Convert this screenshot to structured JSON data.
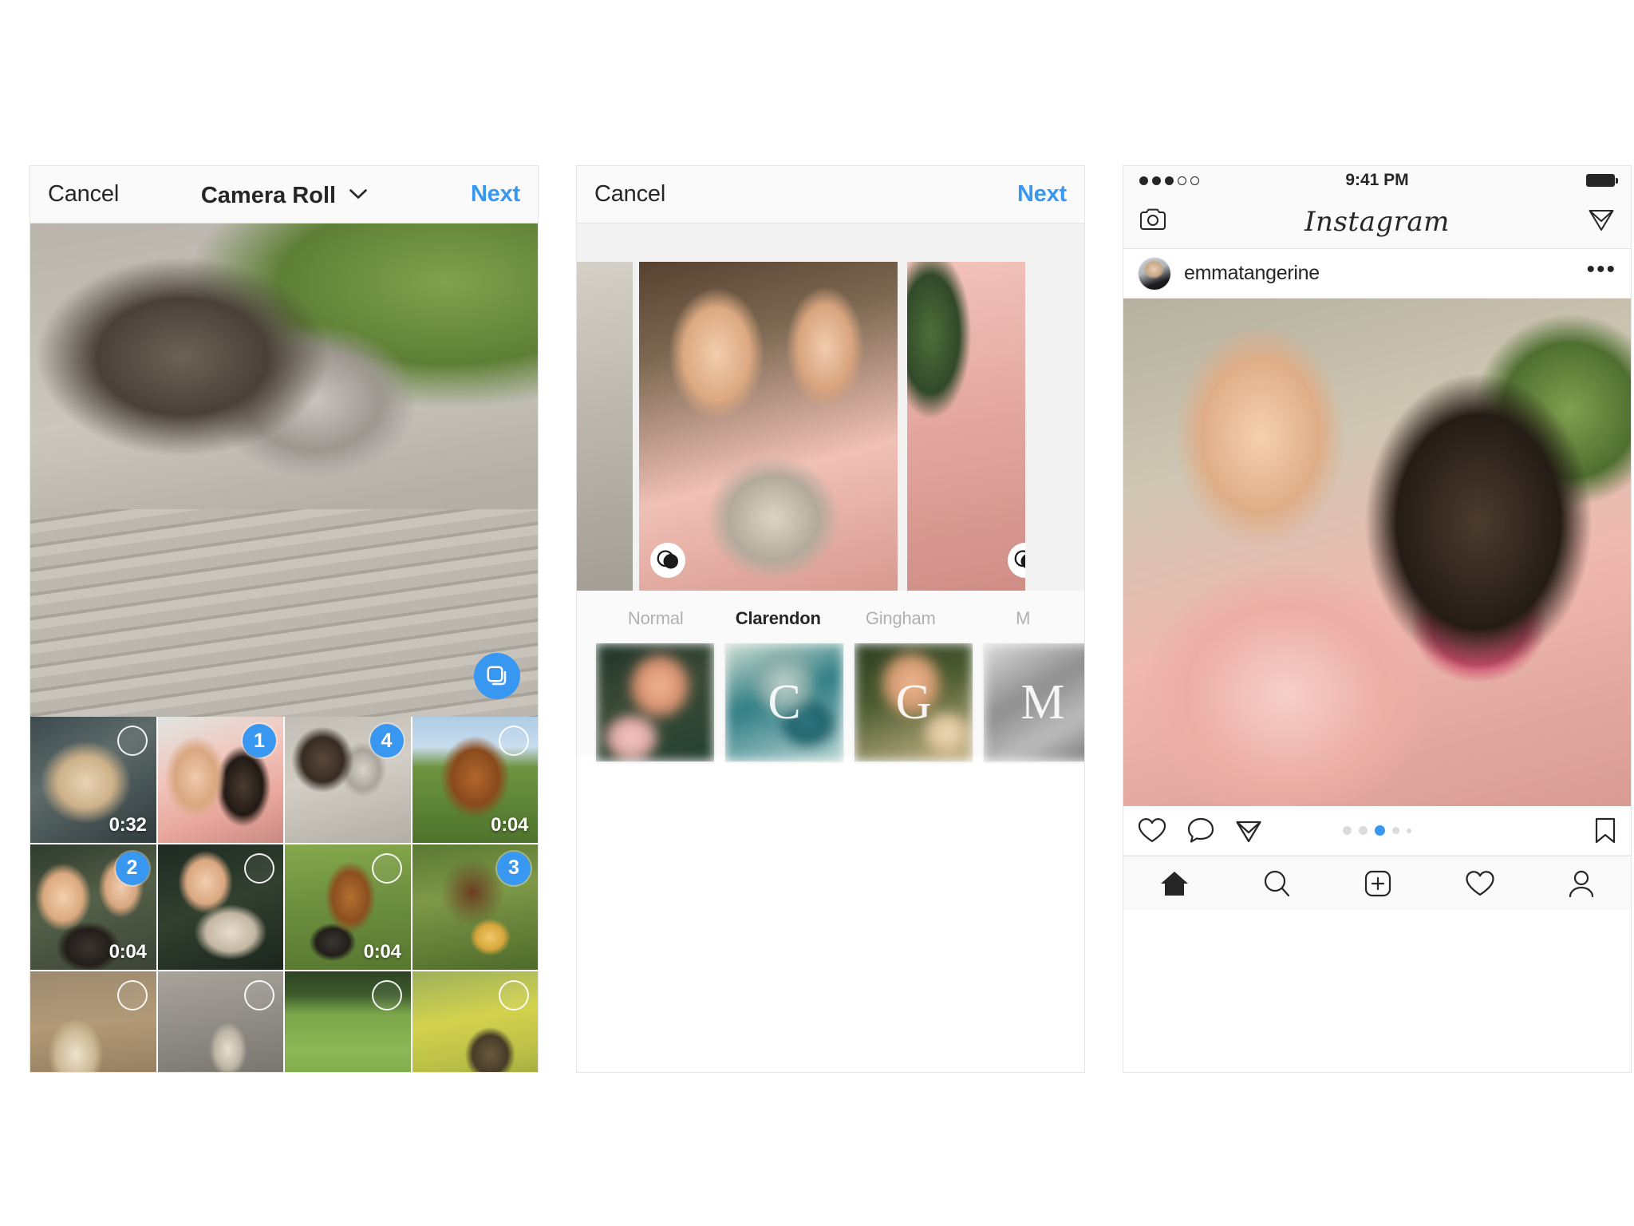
{
  "screens": {
    "picker": {
      "nav": {
        "cancel_label": "Cancel",
        "title": "Camera Roll",
        "chevron_icon": "chevron-down-icon",
        "next_label": "Next"
      },
      "preview": {
        "photo_name": "two-dogs-on-deck",
        "multi_select_icon": "multi-select-stack-icon",
        "multi_select_color": "#3897f0"
      },
      "grid": {
        "columns": 4,
        "thumbnails": [
          {
            "photo_name": "yorkie-closeup",
            "selected": false,
            "badge": "",
            "duration": "0:32"
          },
          {
            "photo_name": "selfie-bernese",
            "selected": true,
            "badge": "1",
            "duration": ""
          },
          {
            "photo_name": "two-small-dogs",
            "selected": true,
            "badge": "4",
            "duration": ""
          },
          {
            "photo_name": "lab-puppy-grass",
            "selected": false,
            "badge": "",
            "duration": "0:04"
          },
          {
            "photo_name": "sunglasses-pair",
            "selected": true,
            "badge": "2",
            "duration": "0:04"
          },
          {
            "photo_name": "girl-with-dog",
            "selected": false,
            "badge": "",
            "duration": ""
          },
          {
            "photo_name": "puppy-on-lawn",
            "selected": false,
            "badge": "",
            "duration": "0:04"
          },
          {
            "photo_name": "dachshund-puppies",
            "selected": true,
            "badge": "3",
            "duration": ""
          },
          {
            "photo_name": "dog-on-dirt",
            "selected": false,
            "badge": "",
            "duration": ""
          },
          {
            "photo_name": "dog-on-rock",
            "selected": false,
            "badge": "",
            "duration": ""
          },
          {
            "photo_name": "green-lawn",
            "selected": false,
            "badge": "",
            "duration": ""
          },
          {
            "photo_name": "yellow-field-dog",
            "selected": false,
            "badge": "",
            "duration": ""
          }
        ]
      }
    },
    "editor": {
      "nav": {
        "cancel_label": "Cancel",
        "next_label": "Next"
      },
      "carousel": {
        "slides": [
          {
            "photo_name": "carousel-prev-edge",
            "adjust_icon": ""
          },
          {
            "photo_name": "selfie-with-dog",
            "adjust_icon": "adjust-contrast-icon"
          },
          {
            "photo_name": "carousel-next-edge",
            "adjust_icon": "adjust-contrast-icon"
          }
        ]
      },
      "filters": [
        {
          "name": "Normal",
          "letter": "",
          "active": false,
          "swatch_name": "filter-preview-normal"
        },
        {
          "name": "Clarendon",
          "letter": "C",
          "active": true,
          "swatch_name": "filter-preview-clarendon"
        },
        {
          "name": "Gingham",
          "letter": "G",
          "active": false,
          "swatch_name": "filter-preview-gingham"
        },
        {
          "name": "M",
          "letter": "M",
          "active": false,
          "swatch_name": "filter-preview-moon"
        }
      ]
    },
    "feed": {
      "statusbar": {
        "signal_icon": "signal-dots-icon",
        "signal_filled": 3,
        "signal_total": 5,
        "time": "9:41 PM",
        "battery_icon": "battery-full-icon"
      },
      "header": {
        "camera_icon": "camera-icon",
        "logo_text": "Instagram",
        "direct_icon": "paper-plane-icon"
      },
      "post": {
        "avatar_name": "user-avatar",
        "username": "emmatangerine",
        "more_icon": "more-options-icon",
        "photo_name": "selfie-with-bernese-dog",
        "actions": {
          "like_icon": "heart-icon",
          "comment_icon": "comment-bubble-icon",
          "share_icon": "paper-plane-icon",
          "save_icon": "bookmark-icon"
        },
        "carousel_dots": {
          "count": 5,
          "active_index": 2,
          "active_color": "#3897f0",
          "inactive_color": "#dbdbdb"
        }
      },
      "tabbar": [
        {
          "name": "home-tab",
          "icon": "home-icon",
          "active": true
        },
        {
          "name": "search-tab",
          "icon": "search-icon",
          "active": false
        },
        {
          "name": "add-tab",
          "icon": "plus-square-icon",
          "active": false
        },
        {
          "name": "activity-tab",
          "icon": "heart-icon",
          "active": false
        },
        {
          "name": "profile-tab",
          "icon": "person-icon",
          "active": false
        }
      ]
    }
  }
}
